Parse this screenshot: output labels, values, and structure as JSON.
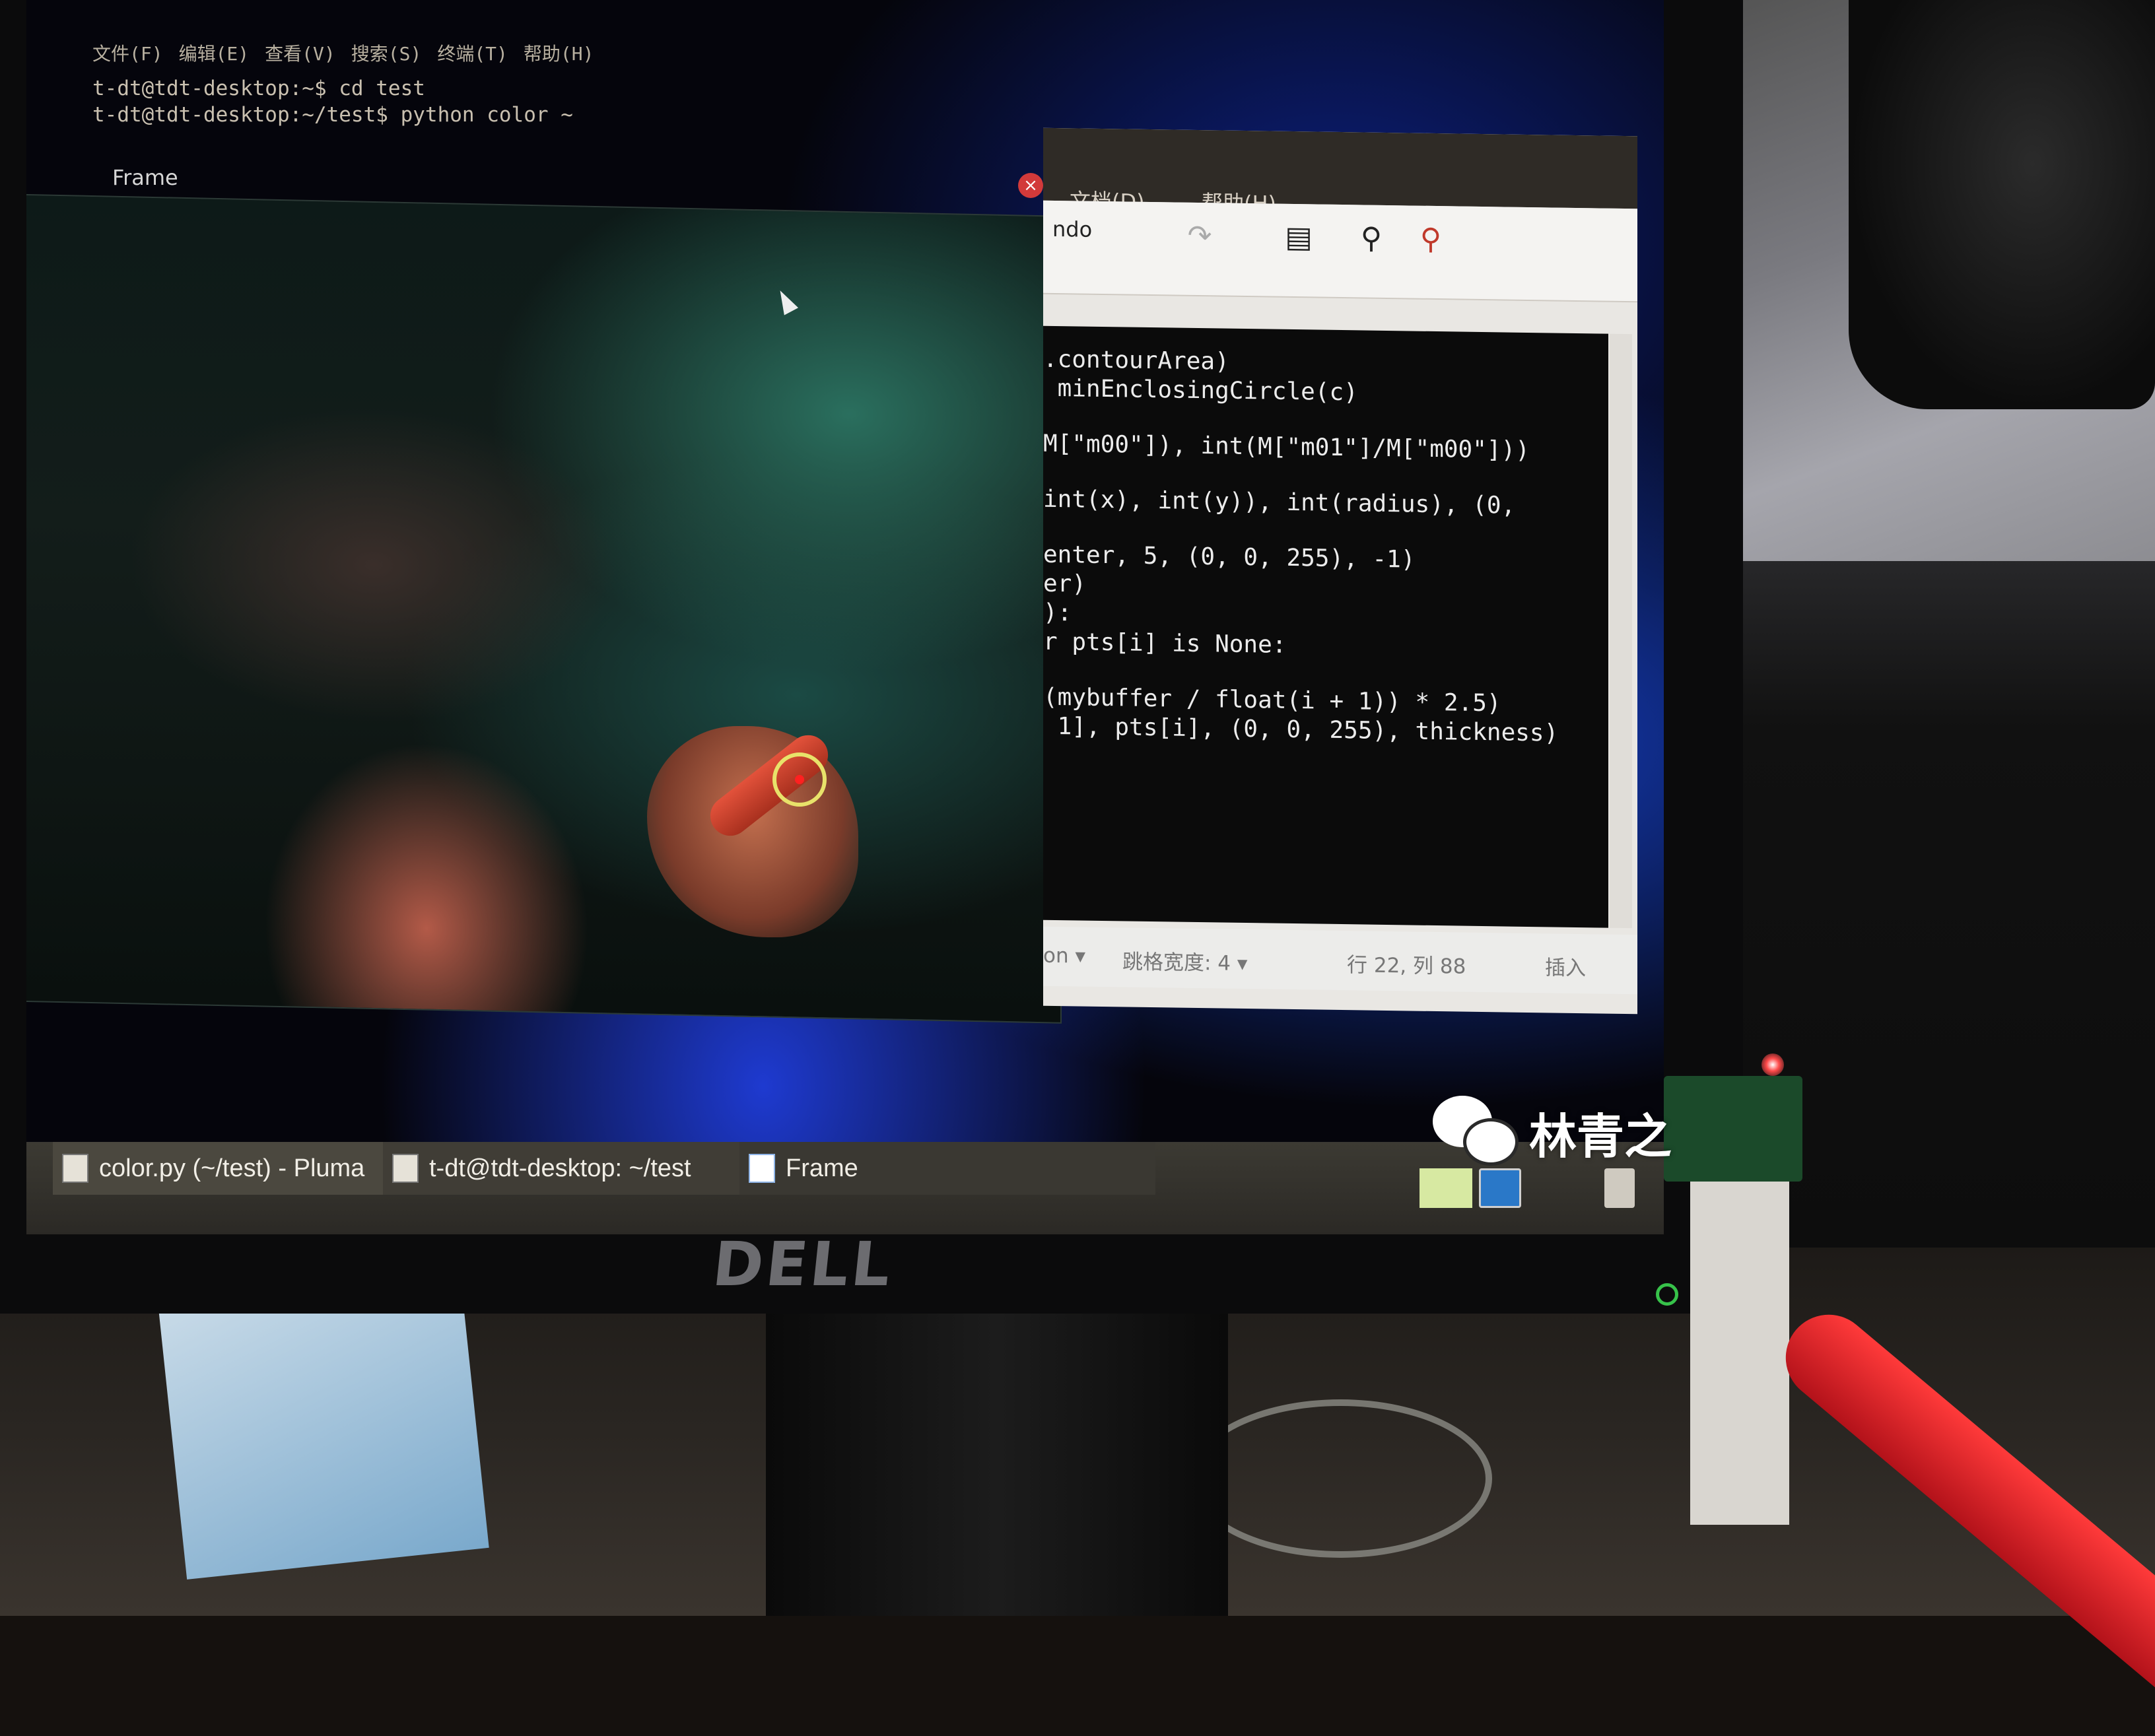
{
  "terminal": {
    "menu": [
      "文件(F)",
      "编辑(E)",
      "查看(V)",
      "搜索(S)",
      "终端(T)",
      "帮助(H)"
    ],
    "lines": [
      "t-dt@tdt-desktop:~$ cd test",
      "t-dt@tdt-desktop:~/test$ python color ~"
    ]
  },
  "frame_window": {
    "title": "Frame",
    "close": "×"
  },
  "pluma": {
    "menu": [
      "文档(D)",
      "帮助(H)"
    ],
    "toolbar_undo_label": "ndo",
    "code": [
      ".contourArea)",
      " minEnclosingCircle(c)",
      "M[\"m00\"]), int(M[\"m01\"]/M[\"m00\"]))",
      "int(x), int(y)), int(radius), (0,",
      "enter, 5, (0, 0, 255), -1)",
      "er)",
      "):",
      "r pts[i] is None:",
      "(mybuffer / float(i + 1)) * 2.5)",
      " 1], pts[i], (0, 0, 255), thickness)"
    ],
    "status": {
      "language": "on ▾",
      "tab_width": "跳格宽度: 4 ▾",
      "position": "行 22, 列 88",
      "mode": "插入"
    }
  },
  "taskbar": {
    "items": [
      "color.py (~/test) - Pluma",
      "t-dt@tdt-desktop: ~/test",
      "Frame"
    ]
  },
  "watermark": {
    "text": "林青之"
  },
  "monitor": {
    "brand": "DELL"
  }
}
